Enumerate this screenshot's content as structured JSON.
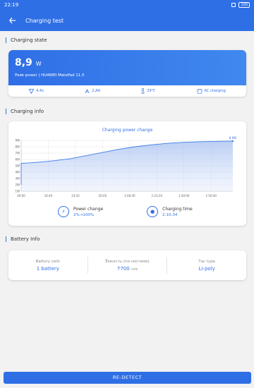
{
  "status": {
    "time": "22:19",
    "battery": "100"
  },
  "header": {
    "title": "Charging test"
  },
  "sections": {
    "state": "Charging state",
    "info": "Charging info",
    "battery": "Battery Info"
  },
  "state": {
    "power_value": "8,9",
    "power_unit": "W",
    "peak_label": "Peak power | HUAWEI MatePad 11.5",
    "voltage": "4,4v",
    "current": "2,AA",
    "temperature": "29℃",
    "charge_type": "AC charging"
  },
  "chart_data": {
    "type": "area",
    "title": "Charging power change",
    "x_ticks": [
      "00:00",
      "16:40",
      "33:20",
      "50:00",
      "1:06:40",
      "1:23:20",
      "1:40:00",
      "1:56:40"
    ],
    "y_ticks": [
      "1W",
      "2W",
      "3W",
      "4W",
      "5W",
      "6W",
      "7W",
      "8W",
      "9W"
    ],
    "ylim": [
      1,
      9
    ],
    "x": [
      0,
      5,
      10,
      20,
      30,
      40,
      50,
      60,
      70,
      80,
      90,
      100,
      110,
      120,
      130
    ],
    "y": [
      5.4,
      5.45,
      5.55,
      5.8,
      6.1,
      6.6,
      7.1,
      7.6,
      8.0,
      8.3,
      8.55,
      8.7,
      8.8,
      8.85,
      8.9
    ],
    "end_label": "8.9W",
    "color": "#3b7be8"
  },
  "chart_info": {
    "power_change_label": "Power change",
    "power_change_value": "2%→100%",
    "charging_time_label": "Charging time",
    "charging_time_value": "2:10:34"
  },
  "battery": {
    "cells_label": "Battery cells",
    "cells_value": "1 battery",
    "capacity_label": "Ёмкость (по системе)",
    "capacity_value": "7700",
    "capacity_unit": "mAh",
    "type_label": "Тас type",
    "type_value": "Li-poly"
  },
  "footer": {
    "redetect_label": "RE-DETECT"
  }
}
